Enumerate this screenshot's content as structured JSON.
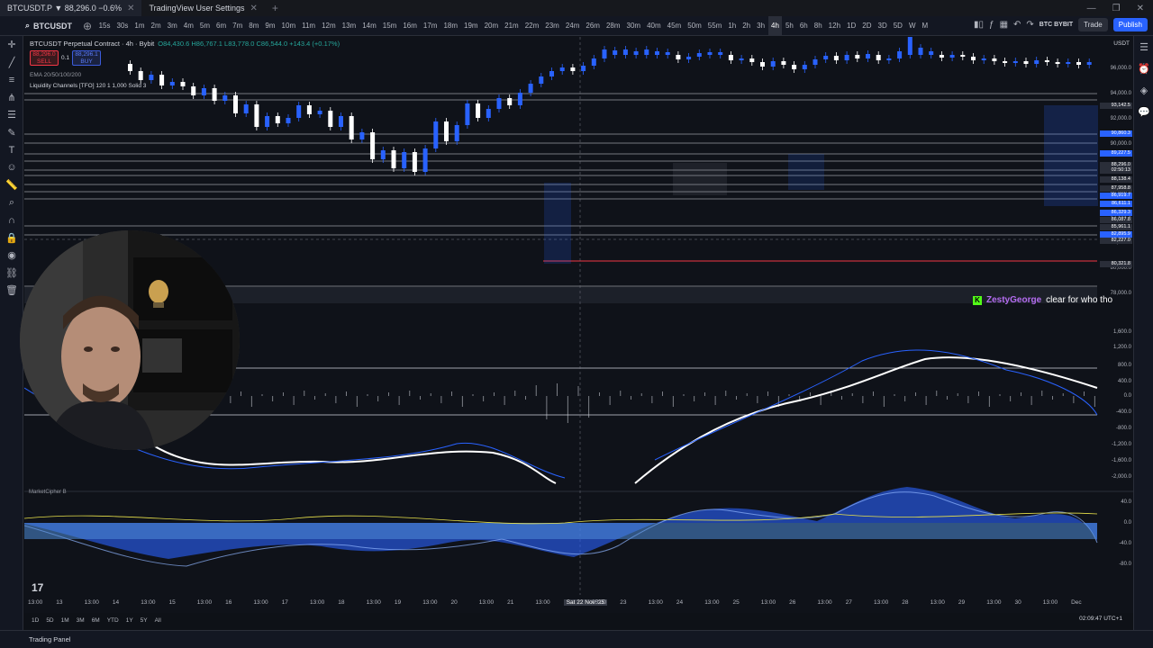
{
  "tabs": [
    {
      "label": "BTCUSDT.P ▼ 88,296.0 −0.6%",
      "active": true
    },
    {
      "label": "TradingView User Settings",
      "active": false
    }
  ],
  "window_controls": [
    "—",
    "❐",
    "✕"
  ],
  "toolbar": {
    "symbol": "BTCUSDT",
    "timeframes": [
      "15s",
      "30s",
      "1m",
      "2m",
      "3m",
      "4m",
      "5m",
      "6m",
      "7m",
      "8m",
      "9m",
      "10m",
      "11m",
      "12m",
      "13m",
      "14m",
      "15m",
      "16m",
      "17m",
      "18m",
      "19m",
      "20m",
      "21m",
      "22m",
      "23m",
      "24m",
      "26m",
      "28m",
      "30m",
      "40m",
      "45m",
      "50m",
      "55m",
      "1h",
      "2h",
      "3h",
      "4h",
      "5h",
      "6h",
      "8h",
      "12h",
      "1D",
      "2D",
      "3D",
      "5D",
      "W",
      "M"
    ],
    "active_timeframe": "4h",
    "broker": "BTC BYBIT",
    "trade_label": "Trade",
    "publish_label": "Publish"
  },
  "chart": {
    "legend_symbol": "BTCUSDT Perpetual Contract · 4h · Bybit",
    "legend_ohlc": "O84,430.6 H86,767.1 L83,778.0 C86,544.0 +143.4 (+0.17%)",
    "sell_price": "88,296.0",
    "sell_label": "SELL",
    "buy_price": "88,296.1",
    "buy_label": "BUY",
    "spread": "0.1",
    "indicator1": "EMA 20/50/100/200",
    "indicator2": "Liquidity Channels [TFO] 120 1 1,000 Solid 3",
    "currency": "USDT",
    "price_labels": [
      "96,000.0",
      "94,000.0",
      "92,000.0",
      "90,000.0",
      "88,000.0",
      "86,000.0",
      "84,000.0",
      "82,000.0",
      "80,000.0",
      "78,000.0"
    ],
    "price_badges": [
      {
        "text": "93,142.5",
        "color": "#2a2e39"
      },
      {
        "text": "90,860.3",
        "color": "#2962ff"
      },
      {
        "text": "89,227.5",
        "color": "#2962ff"
      },
      {
        "text": "88,296.0",
        "color": "#2a2e39"
      },
      {
        "text": "02:50:13",
        "color": "#2a2e39"
      },
      {
        "text": "88,138.4",
        "color": "#2a2e39"
      },
      {
        "text": "87,958.8",
        "color": "#2a2e39"
      },
      {
        "text": "86,919.7",
        "color": "#2962ff"
      },
      {
        "text": "86,611.1",
        "color": "#2962ff"
      },
      {
        "text": "86,329.3",
        "color": "#2962ff"
      },
      {
        "text": "86,087.8",
        "color": "#2a2e39"
      },
      {
        "text": "85,961.1",
        "color": "#2a2e39"
      },
      {
        "text": "82,895.9",
        "color": "#2962ff"
      },
      {
        "text": "82,227.0",
        "color": "#2a2e39"
      },
      {
        "text": "80,321.8",
        "color": "#2a2e39"
      }
    ],
    "osc_labels": [
      "1,600.0",
      "1,200.0",
      "800.0",
      "400.0",
      "0.0",
      "-400.0",
      "-800.0",
      "-1,200.0",
      "-1,600.0",
      "-2,000.0"
    ],
    "mc_labels": [
      "40.0",
      "0.0",
      "-40.0",
      "-80.0"
    ],
    "mc_title": "MarketCipher B"
  },
  "time_axis": [
    "13:00",
    "13",
    "13:00",
    "14",
    "13:00",
    "15",
    "13:00",
    "16",
    "13:00",
    "17",
    "13:00",
    "18",
    "13:00",
    "19",
    "13:00",
    "20",
    "13:00",
    "21",
    "13:00",
    "Sat 22 Nov '25",
    "05:00",
    "23",
    "13:00",
    "24",
    "13:00",
    "25",
    "13:00",
    "26",
    "13:00",
    "27",
    "13:00",
    "28",
    "13:00",
    "29",
    "13:00",
    "30",
    "13:00",
    "Dec"
  ],
  "ranges": [
    "1D",
    "5D",
    "1M",
    "3M",
    "6M",
    "YTD",
    "1Y",
    "5Y",
    "All"
  ],
  "clock": "02:09:47 UTC+1",
  "chat": {
    "user": "ZestyGeorge",
    "message": "clear for who tho"
  },
  "trading_panel": "Trading Panel"
}
